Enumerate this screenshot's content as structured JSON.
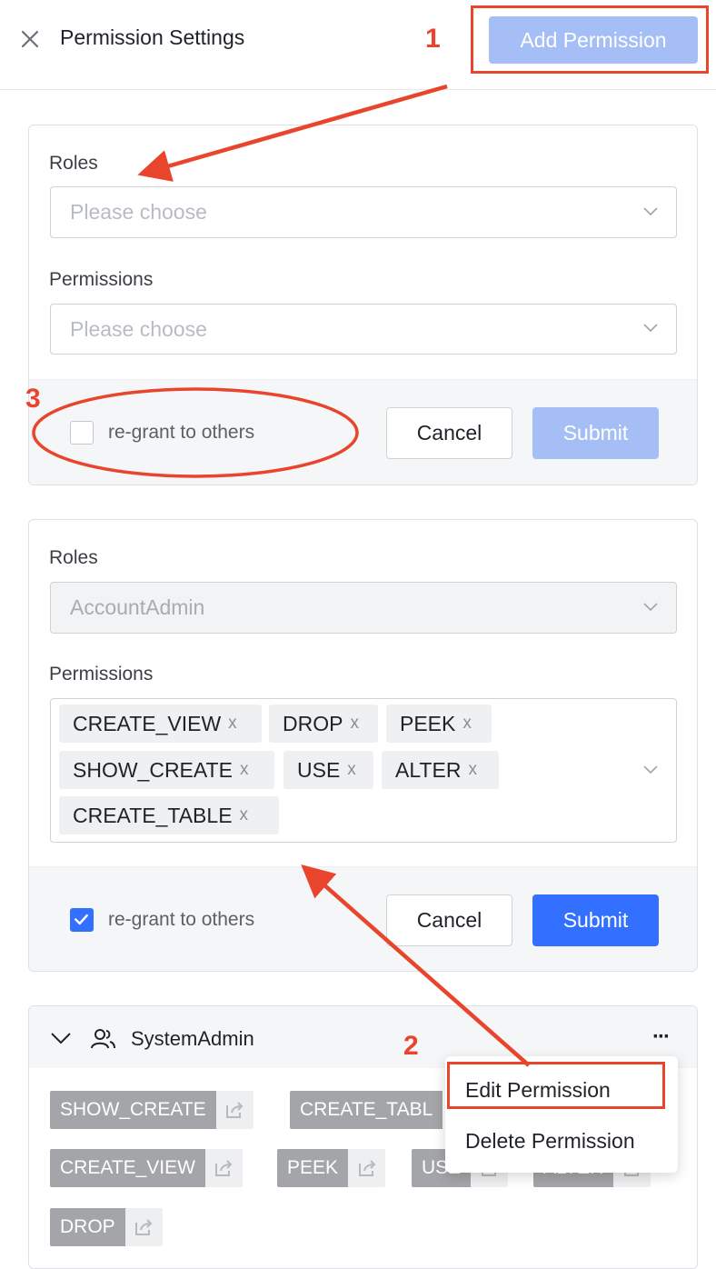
{
  "header": {
    "title": "Permission Settings",
    "add_button": "Add Permission"
  },
  "new_form": {
    "roles_label": "Roles",
    "roles_placeholder": "Please choose",
    "permissions_label": "Permissions",
    "permissions_placeholder": "Please choose",
    "regrant_label": "re-grant to others",
    "regrant_checked": false,
    "cancel_label": "Cancel",
    "submit_label": "Submit"
  },
  "edit_form": {
    "roles_label": "Roles",
    "role_value": "AccountAdmin",
    "permissions_label": "Permissions",
    "permissions": [
      "CREATE_VIEW",
      "DROP",
      "PEEK",
      "SHOW_CREATE",
      "USE",
      "ALTER",
      "CREATE_TABLE"
    ],
    "tag_remove_glyph": "x",
    "regrant_label": "re-grant to others",
    "regrant_checked": true,
    "cancel_label": "Cancel",
    "submit_label": "Submit"
  },
  "group": {
    "role_name": "SystemAdmin",
    "more_glyph": "···",
    "permissions": [
      "SHOW_CREATE",
      "CREATE_TABL",
      "CREATE_VIEW",
      "PEEK",
      "USE",
      "ALTER",
      "DROP"
    ]
  },
  "context_menu": {
    "items": [
      "Edit Permission",
      "Delete Permission"
    ]
  },
  "annotations": {
    "step1": "1",
    "step2": "2",
    "step3": "3",
    "color": "#e8452c"
  },
  "colors": {
    "primary": "#3370ff",
    "primary_disabled": "#a5bef5",
    "tag_gray": "#a3a5a8"
  }
}
